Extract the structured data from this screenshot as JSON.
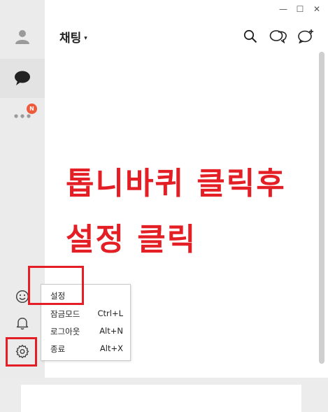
{
  "window": {
    "controls": {
      "minimize": "—",
      "maximize": "☐",
      "close": "✕"
    }
  },
  "header": {
    "title": "채팅",
    "caret": "▾"
  },
  "sidebar": {
    "badge": "N"
  },
  "annotation": {
    "line1": "톱니바퀴 클릭후",
    "line2": "설정 클릭",
    "color": "#e31e24"
  },
  "context_menu": {
    "items": [
      {
        "label": "설정",
        "shortcut": ""
      },
      {
        "label": "잠금모드",
        "shortcut": "Ctrl+L"
      },
      {
        "label": "로그아웃",
        "shortcut": "Alt+N"
      },
      {
        "label": "종료",
        "shortcut": "Alt+X"
      }
    ]
  },
  "colors": {
    "sidebar_bg": "#ebebeb",
    "badge": "#f05a3b",
    "highlight": "#e31e24"
  },
  "icons": {
    "sidebar_top": "profile-icon",
    "sidebar_chat": "chat-icon",
    "sidebar_more": "more-icon",
    "sidebar_emoji": "emoji-icon",
    "sidebar_bell": "bell-icon",
    "sidebar_settings": "gear-icon",
    "header_search": "search-icon",
    "header_open_chat": "open-chat-icon",
    "header_new_chat": "new-chat-icon"
  }
}
